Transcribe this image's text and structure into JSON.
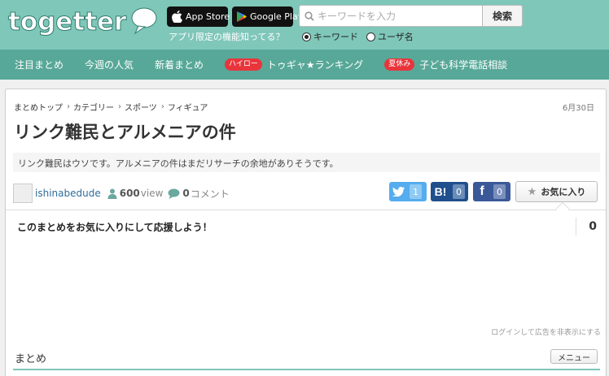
{
  "header": {
    "logo_text": "togetter",
    "app_store_label": "App Store",
    "google_play_label": "Google Play",
    "promo_text": "アプリ限定の機能知ってる？",
    "search_placeholder": "キーワードを入力",
    "search_button": "検索",
    "search_modes": [
      {
        "label": "キーワード",
        "checked": true
      },
      {
        "label": "ユーザ名",
        "checked": false
      }
    ]
  },
  "nav": {
    "items": [
      {
        "label": "注目まとめ"
      },
      {
        "label": "今週の人気"
      },
      {
        "label": "新着まとめ"
      },
      {
        "badge": "ハイロー",
        "label": "トゥギャ★ランキング"
      },
      {
        "badge": "夏休み",
        "label": "子ども科学電話相談"
      }
    ]
  },
  "article": {
    "breadcrumb": [
      "まとめトップ",
      "カテゴリー",
      "スポーツ",
      "フィギュア"
    ],
    "date": "6月30日",
    "title": "リンク難民とアルメニアの件",
    "description": "リンク難民はウソです。アルメニアの件はまだリサーチの余地がありそうです。",
    "author": "ishinabedude",
    "views": "600",
    "views_unit": "view",
    "comments": "0",
    "comments_unit": "コメント",
    "share": {
      "twitter_count": "1",
      "hatena_count": "0",
      "facebook_count": "0",
      "hatena_icon": "B!",
      "facebook_icon": "f"
    },
    "favorite_label": "お気に入り",
    "support_text": "このまとめをお気に入りにして応援しよう！",
    "support_count": "0",
    "ad_hide_text": "ログインして広告を非表示にする",
    "section_title": "まとめ",
    "menu_label": "メニュー"
  },
  "colors": {
    "header_bg": "#7fc7b9",
    "nav_bg": "#57a898",
    "badge_red": "#e8353c",
    "twitter": "#55acee",
    "hatena": "#1f4f8c",
    "facebook": "#3b5998"
  }
}
